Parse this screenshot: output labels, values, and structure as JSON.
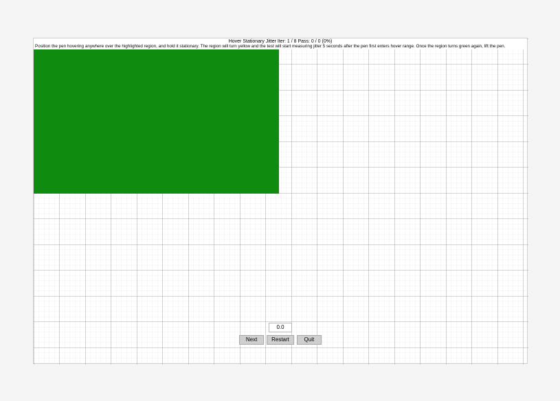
{
  "test": {
    "title": "Hover Stationary Jitter",
    "iter_label": "Iter:",
    "iter_current": 1,
    "iter_total": 8,
    "pass_label": "Pass:",
    "pass_current": 0,
    "pass_total": 0,
    "pass_pct": "0%"
  },
  "instruction": "Position the pen hovering anywhere over the highlighted region, and hold it stationary. The region will turn yellow and the test will start measuring jitter 5 seconds after the pen first enters hover range. Once the region turns green again, lift the pen.",
  "readout": {
    "value": "0.0"
  },
  "buttons": {
    "next": "Next",
    "restart": "Restart",
    "quit": "Quit"
  },
  "colors": {
    "highlight": "#0f8b0f",
    "grid_minor": "#d8d8d8",
    "grid_major": "#9a9a9a"
  },
  "status_line": "Hover Stationary Jitter   Iter: 1 / 8   Pass: 0 / 0 (0%)"
}
